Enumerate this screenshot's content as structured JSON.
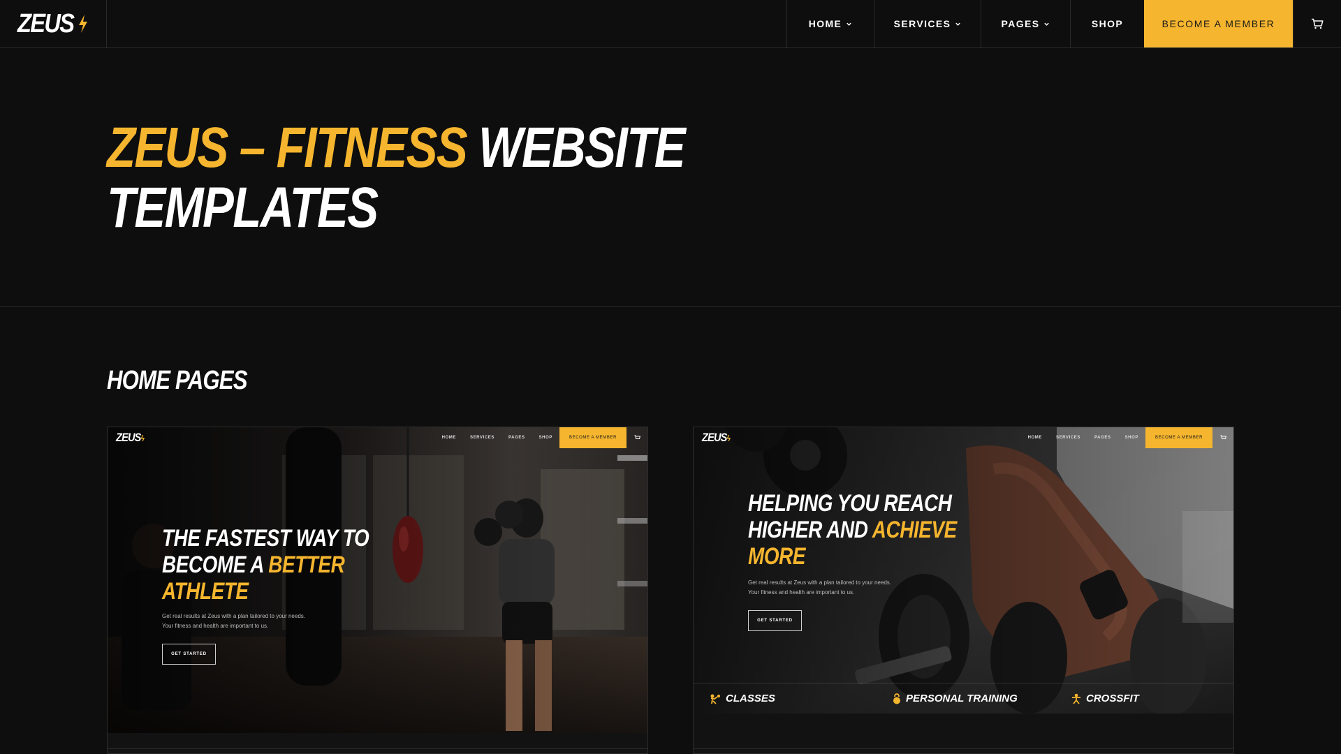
{
  "header": {
    "logo": "ZEUS",
    "nav": {
      "home": "HOME",
      "services": "SERVICES",
      "pages": "PAGES",
      "shop": "SHOP",
      "cta": "BECOME A MEMBER"
    }
  },
  "hero": {
    "title_accent": "ZEUS – FITNESS",
    "title_rest": "WEBSITE TEMPLATES"
  },
  "section": {
    "title": "HOME PAGES"
  },
  "cards": [
    {
      "logo": "ZEUS",
      "nav": [
        "HOME",
        "SERVICES",
        "PAGES",
        "SHOP"
      ],
      "cta": "BECOME A MEMBER",
      "headline_white": "THE FASTEST WAY TO BECOME A",
      "headline_accent": "BETTER ATHLETE",
      "sub_line1": "Get real results at Zeus with a plan tailored to your needs.",
      "sub_line2": "Your fitness and health are important to us.",
      "button": "GET STARTED"
    },
    {
      "logo": "ZEUS",
      "nav": [
        "HOME",
        "SERVICES",
        "PAGES",
        "SHOP"
      ],
      "cta": "BECOME A MEMBER",
      "headline_white": "HELPING YOU REACH HIGHER AND",
      "headline_accent": "ACHIEVE MORE",
      "sub_line1": "Get real results at Zeus with a plan tailored to your needs.",
      "sub_line2": "Your fitness and health are important to us.",
      "button": "GET STARTED",
      "features": [
        "CLASSES",
        "PERSONAL TRAINING",
        "CROSSFIT"
      ]
    }
  ],
  "colors": {
    "background": "#0e0e0e",
    "accent": "#f5b52e",
    "border": "#2a2a2a"
  },
  "icons": [
    "bolt-icon",
    "chevron-down-icon",
    "cart-icon",
    "boxing-icon",
    "kettlebell-icon",
    "athlete-icon"
  ]
}
